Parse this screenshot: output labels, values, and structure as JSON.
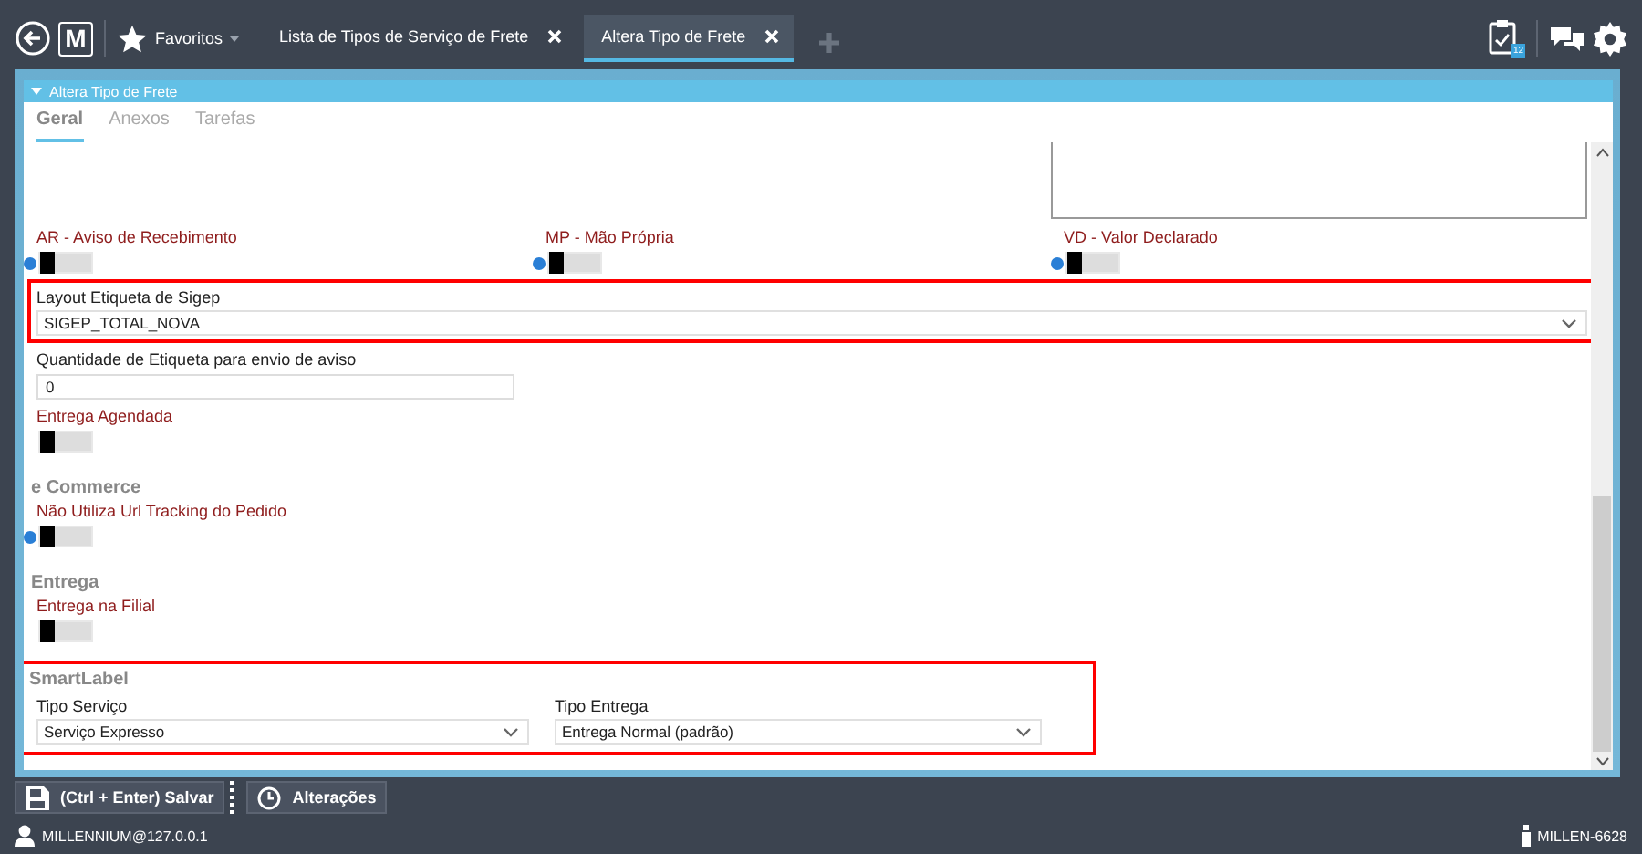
{
  "top_bar": {
    "logo": "M",
    "favorites": "Favoritos",
    "task_badge": "12",
    "tabs": [
      {
        "label": "Lista de Tipos de Serviço de Frete",
        "selected": false
      },
      {
        "label": "Altera Tipo de Frete",
        "selected": true
      }
    ]
  },
  "panel": {
    "title": "Altera Tipo de Frete",
    "tabs": [
      {
        "label": "Geral",
        "selected": true
      },
      {
        "label": "Anexos",
        "selected": false
      },
      {
        "label": "Tarefas",
        "selected": false
      }
    ]
  },
  "options": [
    {
      "label": "AR - Aviso de Recebimento",
      "help": true,
      "on": false
    },
    {
      "label": "MP - Mão Própria",
      "help": true,
      "on": false
    },
    {
      "label": "VD - Valor Declarado",
      "help": true,
      "on": false
    }
  ],
  "layout_field": {
    "label": "Layout Etiqueta de Sigep",
    "value": "SIGEP_TOTAL_NOVA",
    "highlighted": true
  },
  "quantity_field": {
    "label": "Quantidade de Etiqueta para envio de aviso",
    "value": "0"
  },
  "scheduled": {
    "label": "Entrega Agendada",
    "help": false,
    "on": false
  },
  "sections": [
    {
      "title": "e Commerce",
      "toggles": [
        {
          "label": "Não Utiliza Url Tracking do Pedido",
          "help": true,
          "on": false
        }
      ]
    },
    {
      "title": "Entrega",
      "toggles": [
        {
          "label": "Entrega na Filial",
          "help": false,
          "on": false
        }
      ]
    }
  ],
  "smartlabel": {
    "title": "SmartLabel",
    "highlighted": true,
    "selects": [
      {
        "label": "Tipo Serviço",
        "value": "Serviço Expresso"
      },
      {
        "label": "Tipo Entrega",
        "value": "Entrega Normal (padrão)"
      }
    ]
  },
  "toolbar": [
    {
      "label": "(Ctrl + Enter) Salvar",
      "kind": "save"
    },
    {
      "label": "Alterações",
      "kind": "history"
    }
  ],
  "status_bar": {
    "user": "MILLENNIUM@127.0.0.1",
    "version": "MILLEN-6628"
  }
}
